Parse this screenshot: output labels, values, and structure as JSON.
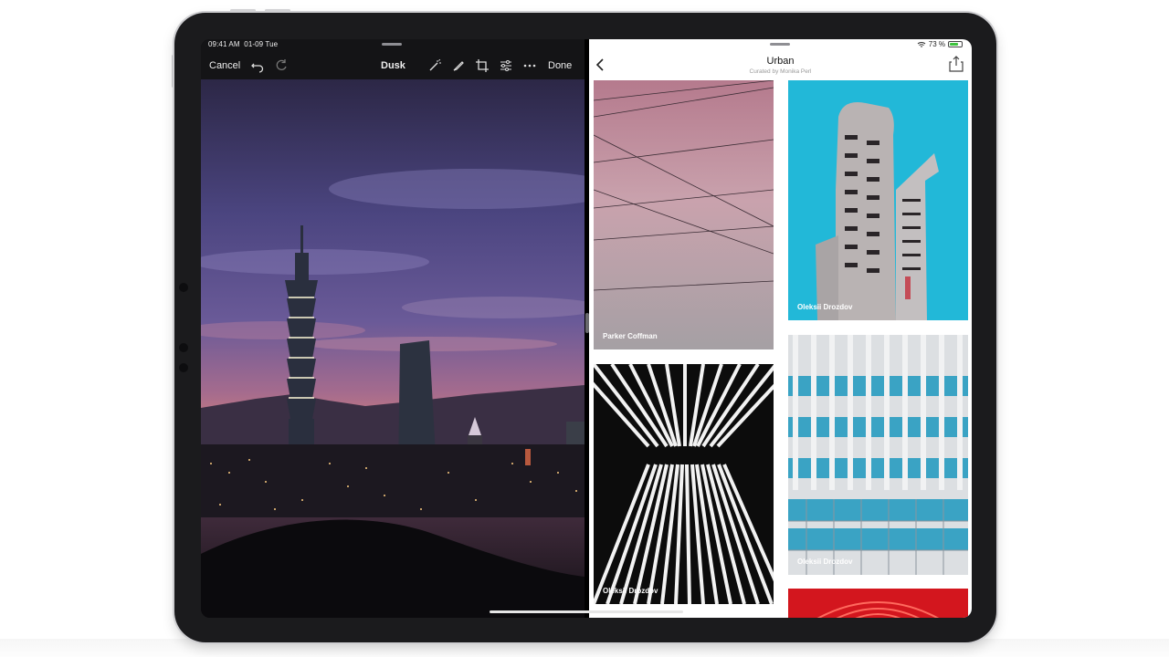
{
  "status": {
    "time": "09:41 AM",
    "date": "01-09 Tue",
    "battery": "73 %",
    "battery_level": 0.73
  },
  "editor": {
    "cancel_label": "Cancel",
    "title": "Dusk",
    "done_label": "Done",
    "tools": [
      "undo-icon",
      "redo-icon",
      "magic-wand-icon",
      "brush-icon",
      "crop-icon",
      "adjust-icon",
      "more-icon"
    ]
  },
  "collection": {
    "title": "Urban",
    "subtitle": "Curated by Monika Perl",
    "photos": [
      {
        "credit": "Parker Coffman"
      },
      {
        "credit": "Oleksii Drozdov"
      },
      {
        "credit": "Oleksii Drozdov"
      },
      {
        "credit": "Oleksii Drozdov"
      }
    ]
  },
  "colors": {
    "accent_sky": "#22b8d8",
    "dusk_purple": "#5a4e8e",
    "dusk_pink": "#c07080"
  }
}
